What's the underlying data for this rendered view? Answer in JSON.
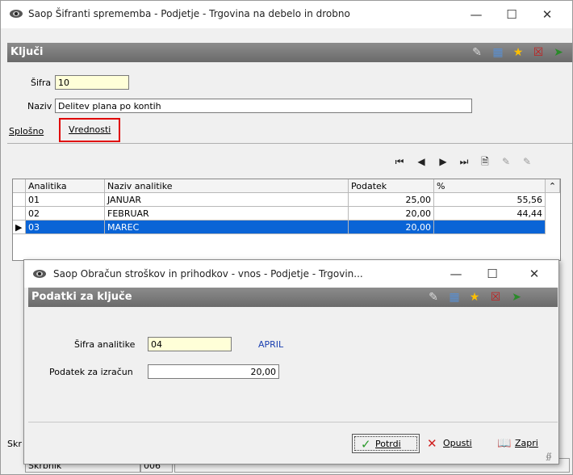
{
  "main_window": {
    "title": "Saop Šifranti sprememba - Podjetje - Trgovina na debelo in drobno",
    "header": "Ključi",
    "sifra_label": "Šifra",
    "sifra_value": "10",
    "naziv_label": "Naziv",
    "naziv_value": "Delitev plana po kontih",
    "tabs": [
      {
        "label": "Splošno"
      },
      {
        "label": "Vrednosti"
      }
    ],
    "grid": {
      "columns": [
        "Analitika",
        "Naziv analitike",
        "Podatek",
        "%"
      ],
      "rows": [
        {
          "analitika": "01",
          "naziv": "JANUAR",
          "podatek": "25,00",
          "pct": "55,56"
        },
        {
          "analitika": "02",
          "naziv": "FEBRUAR",
          "podatek": "20,00",
          "pct": "44,44"
        },
        {
          "analitika": "03",
          "naziv": "MAREC",
          "podatek": "20,00",
          "pct": ""
        }
      ]
    },
    "side_text": "Skr",
    "status": {
      "label": "Skrbnik",
      "value": "006"
    }
  },
  "dialog": {
    "title": "Saop Obračun stroškov in prihodkov - vnos - Podjetje - Trgovin...",
    "header": "Podatki za ključe",
    "sifra_analitike_label": "Šifra analitike",
    "sifra_analitike_value": "04",
    "analitika_name": "APRIL",
    "podatek_label": "Podatek za izračun",
    "podatek_value": "20,00",
    "buttons": {
      "confirm": "Potrdi",
      "cancel": "Opusti",
      "close": "Zapri"
    }
  },
  "colors": {
    "header_bar": "#7a7a7a",
    "selection": "#0a64d6",
    "tab_highlight": "#e00000",
    "link_blue": "#1a3fb0"
  }
}
